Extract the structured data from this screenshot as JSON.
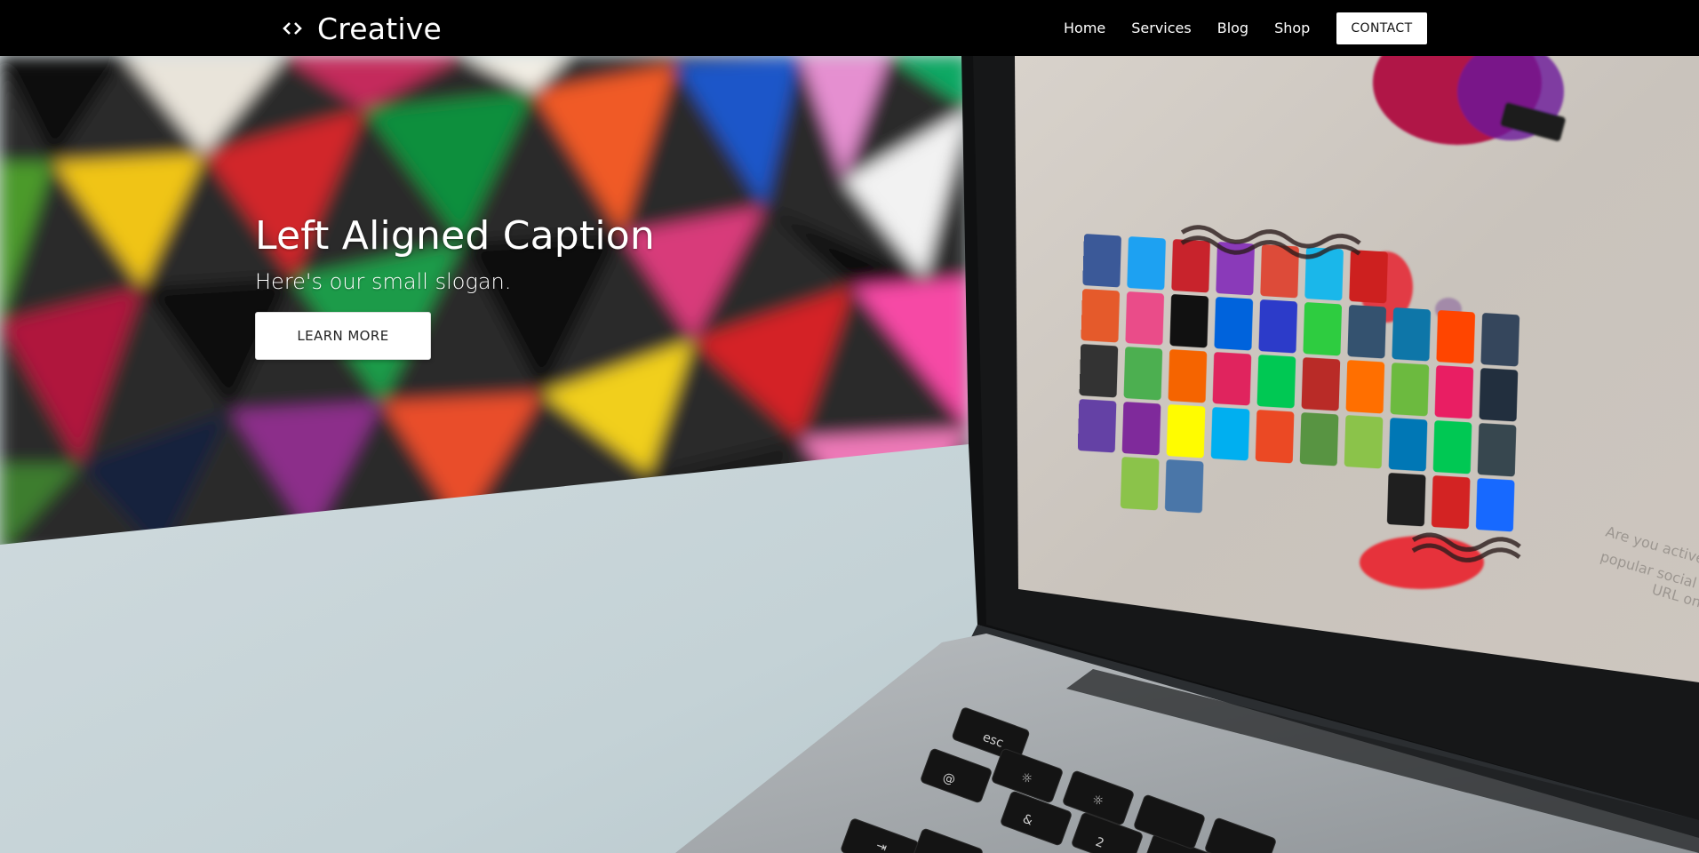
{
  "brand": {
    "name": "Creative",
    "icon": "code-brackets-icon"
  },
  "nav": {
    "links": [
      {
        "label": "Home"
      },
      {
        "label": "Services"
      },
      {
        "label": "Blog"
      },
      {
        "label": "Shop"
      }
    ],
    "contact_label": "CONTACT"
  },
  "hero": {
    "title": "Left Aligned Caption",
    "subtitle": "Here's our small slogan.",
    "cta_label": "LEARN MORE",
    "background": "photo-laptop-social-icons"
  },
  "colors": {
    "navbar": "#000000",
    "button_bg": "#ffffff",
    "text_light": "#ffffff"
  }
}
